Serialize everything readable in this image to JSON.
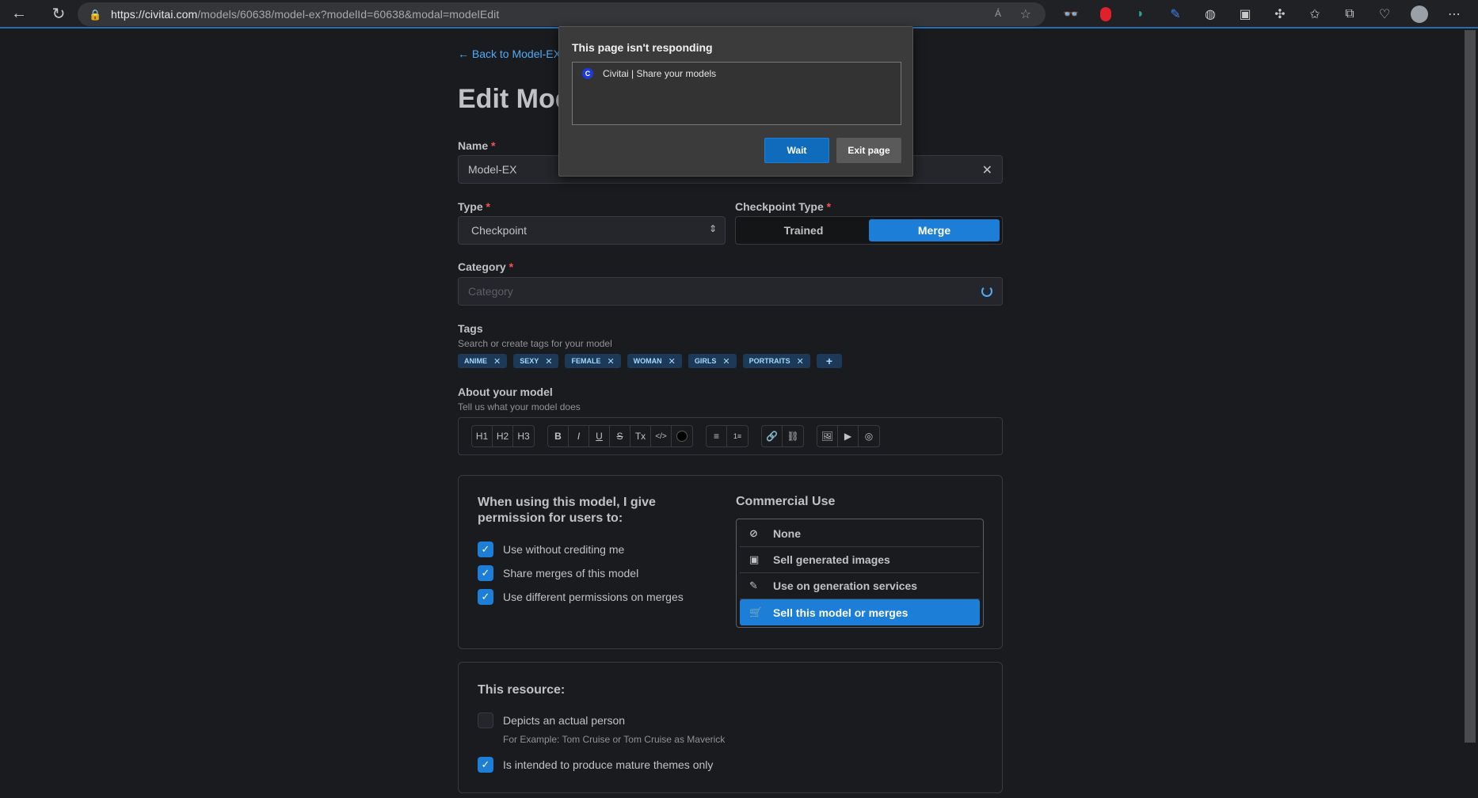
{
  "browser": {
    "url_host": "https://civitai.com",
    "url_path": "/models/60638/model-ex?modelId=60638&modal=modelEdit",
    "read_aloud": "Á",
    "back_icon": "back-arrow-icon",
    "refresh_icon": "refresh-icon"
  },
  "page": {
    "back_link": "← Back to Model-EX",
    "title": "Edit Model",
    "name_label": "Name",
    "name_value": "Model-EX",
    "type_label": "Type",
    "type_value": "Checkpoint",
    "checkpoint_type_label": "Checkpoint Type",
    "checkpoint_options": [
      "Trained",
      "Merge"
    ],
    "checkpoint_selected": "Merge",
    "category_label": "Category",
    "category_placeholder": "Category",
    "tags_label": "Tags",
    "tags_desc": "Search or create tags for your model",
    "tags": [
      "ANIME",
      "SEXY",
      "FEMALE",
      "WOMAN",
      "GIRLS",
      "PORTRAITS"
    ],
    "about_label": "About your model",
    "about_desc": "Tell us what your model does",
    "editor_groups": [
      [
        "H1",
        "H2",
        "H3"
      ],
      [
        "B",
        "I",
        "U",
        "S",
        "Tx",
        "</>",
        "●"
      ],
      [
        "≡",
        "1≡"
      ],
      [
        "🔗",
        "⛓"
      ],
      [
        "🖼",
        "▶",
        "◎"
      ]
    ]
  },
  "permissions": {
    "title": "When using this model, I give permission for users to:",
    "items": [
      "Use without crediting me",
      "Share merges of this model",
      "Use different permissions on merges"
    ],
    "commercial_title": "Commercial Use",
    "commercial_items": [
      "None",
      "Sell generated images",
      "Use on generation services",
      "Sell this model or merges"
    ],
    "commercial_selected": "Sell this model or merges"
  },
  "resource": {
    "title": "This resource:",
    "actual_person": "Depicts an actual person",
    "actual_person_desc": "For Example: Tom Cruise or Tom Cruise as Maverick",
    "mature": "Is intended to produce mature themes only"
  },
  "dialog": {
    "title": "This page isn't responding",
    "item": "Civitai | Share your models",
    "favicon": "C",
    "wait": "Wait",
    "exit": "Exit page"
  },
  "colors": {
    "accent": "#1c7ed6",
    "link": "#4dabf7",
    "required": "#fa5252"
  }
}
